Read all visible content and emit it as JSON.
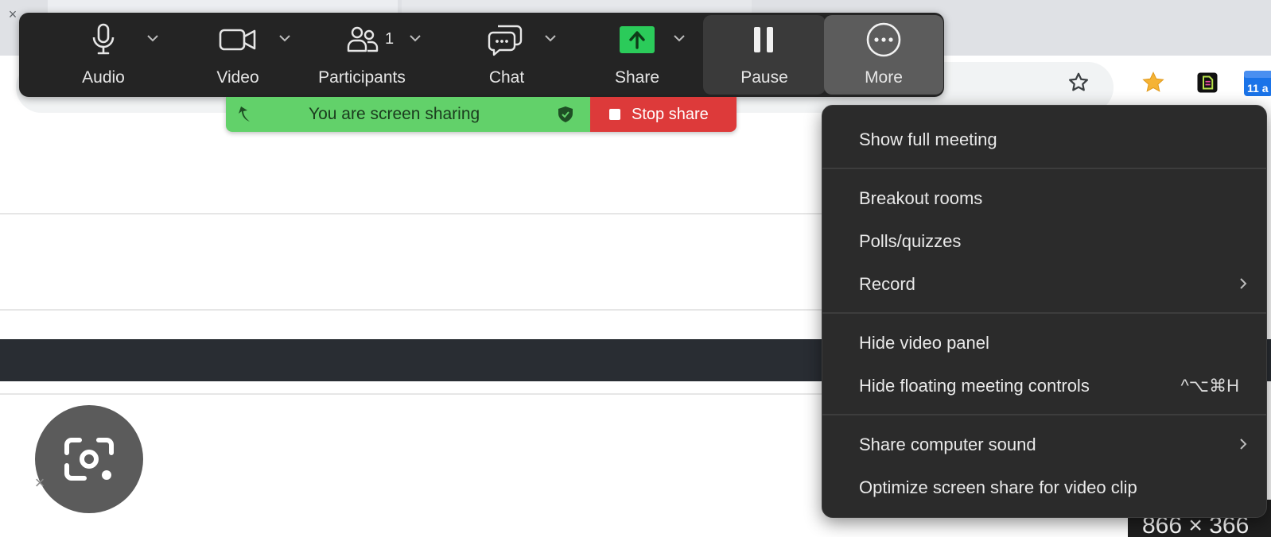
{
  "toolbar": {
    "audio": {
      "label": "Audio",
      "icon": "microphone-icon"
    },
    "video": {
      "label": "Video",
      "icon": "video-camera-icon"
    },
    "participants": {
      "label": "Participants",
      "count": "1",
      "icon": "participants-icon"
    },
    "chat": {
      "label": "Chat",
      "icon": "chat-bubbles-icon"
    },
    "share": {
      "label": "Share",
      "icon": "share-screen-arrow-icon",
      "accent": "#2bcb5a"
    },
    "pause": {
      "label": "Pause",
      "icon": "pause-icon"
    },
    "more": {
      "label": "More",
      "icon": "more-dots-icon"
    }
  },
  "share_status": {
    "message": "You are screen sharing",
    "stop_label": "Stop share",
    "green": "#62d16a",
    "red": "#dd3a3a"
  },
  "more_menu": {
    "items": [
      {
        "label": "Show full meeting"
      },
      {
        "label": "Breakout rooms"
      },
      {
        "label": "Polls/quizzes"
      },
      {
        "label": "Record",
        "submenu": true
      },
      {
        "label": "Hide video panel"
      },
      {
        "label": "Hide floating meeting controls",
        "shortcut": "^⌥⌘H"
      },
      {
        "label": "Share computer sound",
        "submenu": true
      },
      {
        "label": "Optimize screen share for video clip"
      }
    ]
  },
  "browser": {
    "calendar_badge": "11 a",
    "image_size_badge": "866 × 366"
  }
}
